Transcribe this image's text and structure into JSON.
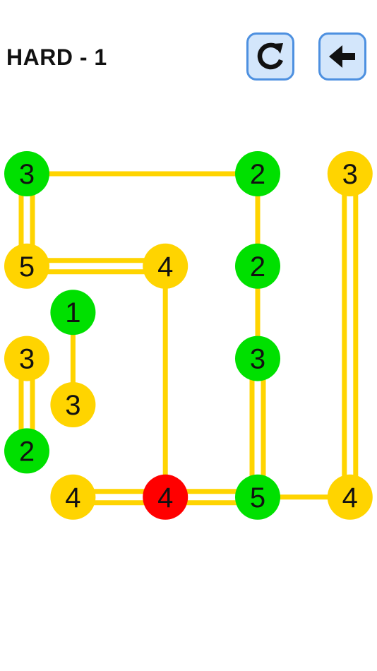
{
  "header": {
    "level_title": "HARD - 1",
    "restart_icon": "restart-icon",
    "back_icon": "arrow-left-icon"
  },
  "colors": {
    "bridge": "#ffd400",
    "island_default": "#ffd400",
    "island_complete": "#00e000",
    "island_error": "#ff0000",
    "button_fill": "#d3e6fb",
    "button_border": "#4d90e0"
  },
  "board": {
    "columns": 8,
    "rows": 8,
    "islands": [
      {
        "id": "a",
        "col": 0,
        "row": 0,
        "value": "3",
        "state": "complete"
      },
      {
        "id": "b",
        "col": 5,
        "row": 0,
        "value": "2",
        "state": "complete"
      },
      {
        "id": "c",
        "col": 7,
        "row": 0,
        "value": "3",
        "state": "default"
      },
      {
        "id": "d",
        "col": 0,
        "row": 2,
        "value": "5",
        "state": "default"
      },
      {
        "id": "e",
        "col": 3,
        "row": 2,
        "value": "4",
        "state": "default"
      },
      {
        "id": "f",
        "col": 5,
        "row": 2,
        "value": "2",
        "state": "complete"
      },
      {
        "id": "g",
        "col": 1,
        "row": 3,
        "value": "1",
        "state": "complete"
      },
      {
        "id": "h",
        "col": 0,
        "row": 4,
        "value": "3",
        "state": "default"
      },
      {
        "id": "i",
        "col": 5,
        "row": 4,
        "value": "3",
        "state": "complete"
      },
      {
        "id": "j",
        "col": 1,
        "row": 5,
        "value": "3",
        "state": "default"
      },
      {
        "id": "k",
        "col": 0,
        "row": 6,
        "value": "2",
        "state": "complete"
      },
      {
        "id": "l",
        "col": 1,
        "row": 7,
        "value": "4",
        "state": "default"
      },
      {
        "id": "m",
        "col": 3,
        "row": 7,
        "value": "4",
        "state": "error"
      },
      {
        "id": "n",
        "col": 5,
        "row": 7,
        "value": "5",
        "state": "complete"
      },
      {
        "id": "o",
        "col": 7,
        "row": 7,
        "value": "4",
        "state": "default"
      }
    ],
    "bridges": [
      {
        "from": "a",
        "to": "b",
        "count": 1
      },
      {
        "from": "a",
        "to": "d",
        "count": 2
      },
      {
        "from": "b",
        "to": "f",
        "count": 1
      },
      {
        "from": "c",
        "to": "o",
        "count": 2
      },
      {
        "from": "d",
        "to": "e",
        "count": 2
      },
      {
        "from": "e",
        "to": "m",
        "count": 1
      },
      {
        "from": "f",
        "to": "i",
        "count": 1
      },
      {
        "from": "g",
        "to": "j",
        "count": 1
      },
      {
        "from": "h",
        "to": "k",
        "count": 2
      },
      {
        "from": "i",
        "to": "n",
        "count": 2
      },
      {
        "from": "l",
        "to": "m",
        "count": 2
      },
      {
        "from": "m",
        "to": "n",
        "count": 2
      },
      {
        "from": "n",
        "to": "o",
        "count": 1
      }
    ]
  }
}
